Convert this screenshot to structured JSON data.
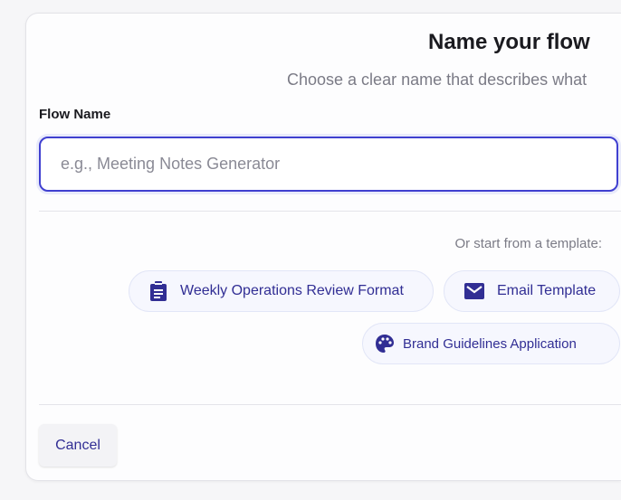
{
  "dialog": {
    "title": "Name your flow",
    "subtitle": "Choose a clear name that describes what",
    "field_label": "Flow Name",
    "field_value": "",
    "field_placeholder": "e.g., Meeting Notes Generator",
    "template_prompt": "Or start from a template:",
    "templates": [
      {
        "label": "Weekly Operations Review Format",
        "icon": "clipboard-icon"
      },
      {
        "label": "Email Template",
        "icon": "envelope-icon"
      },
      {
        "label": "Brand Guidelines Application",
        "icon": "palette-icon"
      }
    ],
    "cancel_label": "Cancel"
  },
  "colors": {
    "accent": "#4040d0",
    "chip_text": "#312e94",
    "chip_bg": "#f6f7fe"
  }
}
